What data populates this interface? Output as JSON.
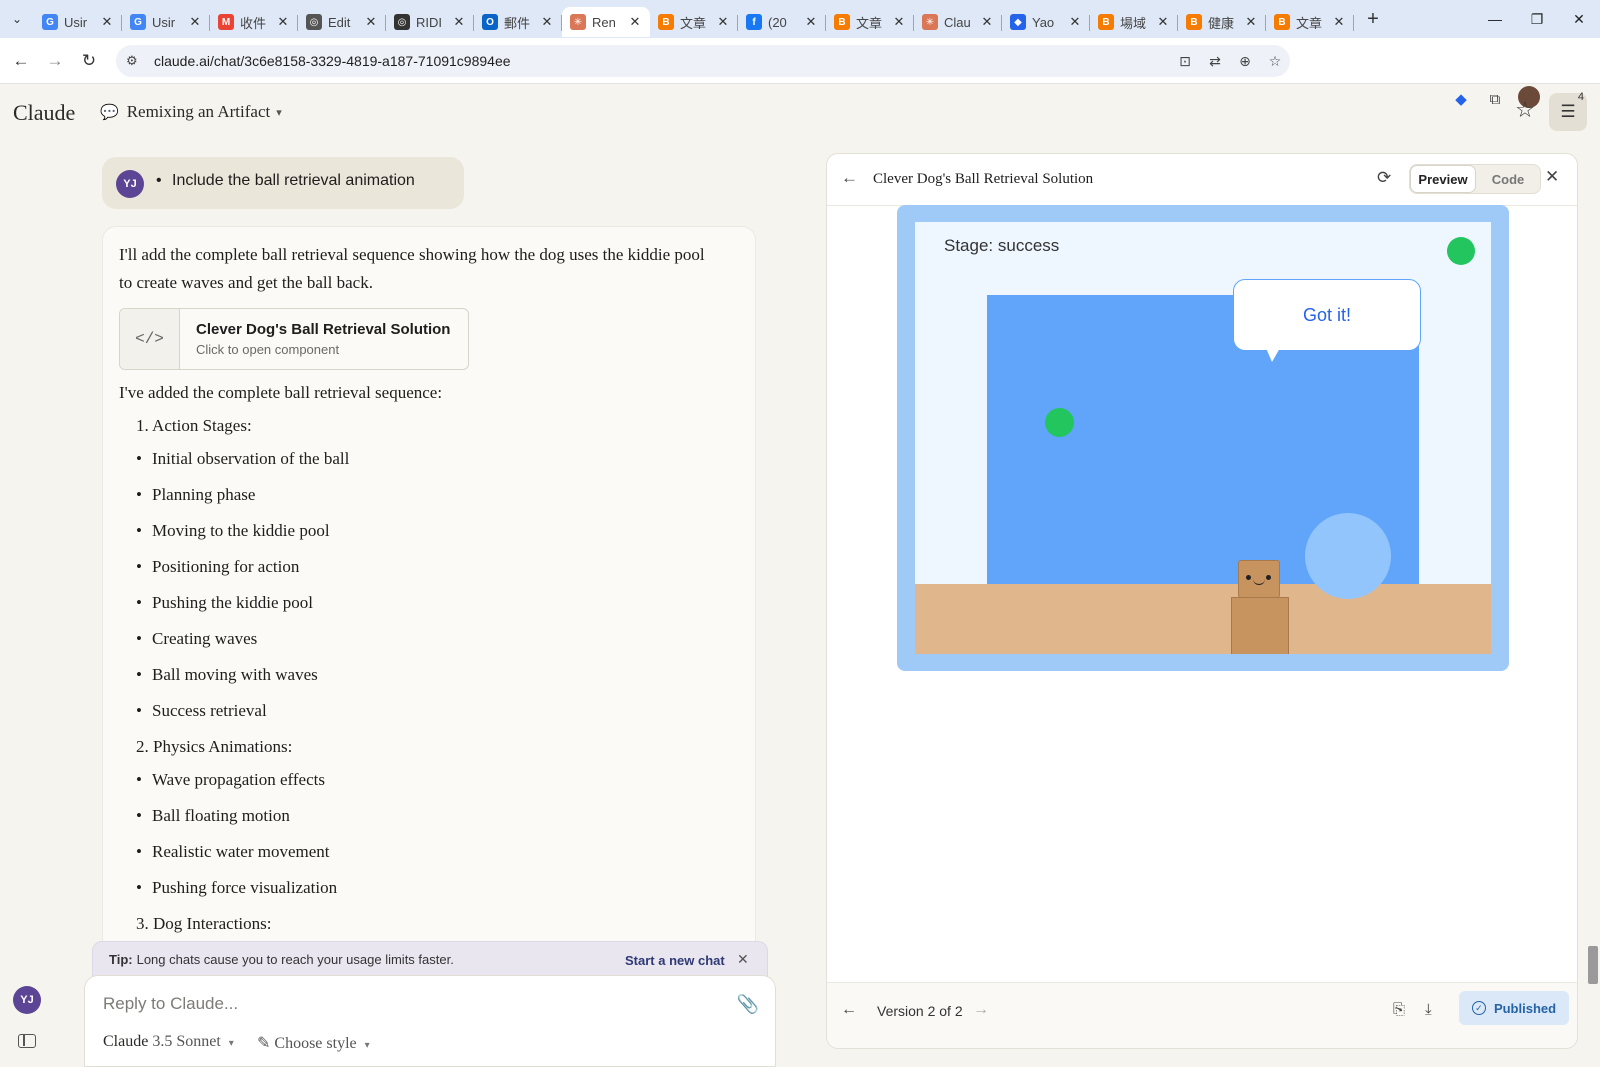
{
  "browser": {
    "tabs": [
      {
        "label": "Usir",
        "favicon_color": "#4285f4",
        "favicon_glyph": "G",
        "active": false
      },
      {
        "label": "Usir",
        "favicon_color": "#4285f4",
        "favicon_glyph": "G",
        "active": false
      },
      {
        "label": "收件",
        "favicon_color": "#ea4335",
        "favicon_glyph": "M",
        "active": false
      },
      {
        "label": "Edit",
        "favicon_color": "#555555",
        "favicon_glyph": "◎",
        "active": false
      },
      {
        "label": "RIDI",
        "favicon_color": "#333333",
        "favicon_glyph": "◎",
        "active": false
      },
      {
        "label": "郵件",
        "favicon_color": "#0a64c8",
        "favicon_glyph": "O",
        "active": false
      },
      {
        "label": "Ren",
        "favicon_color": "#d97757",
        "favicon_glyph": "✳",
        "active": true
      },
      {
        "label": "文章",
        "favicon_color": "#f57c00",
        "favicon_glyph": "B",
        "active": false
      },
      {
        "label": "(20",
        "favicon_color": "#1877f2",
        "favicon_glyph": "f",
        "active": false
      },
      {
        "label": "文章",
        "favicon_color": "#f57c00",
        "favicon_glyph": "B",
        "active": false
      },
      {
        "label": "Clau",
        "favicon_color": "#d97757",
        "favicon_glyph": "✳",
        "active": false
      },
      {
        "label": "Yao",
        "favicon_color": "#2563eb",
        "favicon_glyph": "◆",
        "active": false
      },
      {
        "label": "場域",
        "favicon_color": "#f57c00",
        "favicon_glyph": "B",
        "active": false
      },
      {
        "label": "健康",
        "favicon_color": "#f57c00",
        "favicon_glyph": "B",
        "active": false
      },
      {
        "label": "文章",
        "favicon_color": "#f57c00",
        "favicon_glyph": "B",
        "active": false
      }
    ],
    "url": "claude.ai/chat/3c6e8158-3329-4819-a187-71091c9894ee"
  },
  "app": {
    "brand": "Claude",
    "conversation_title": "Remixing an Artifact",
    "settings_badge": "4"
  },
  "chat": {
    "user_initials": "YJ",
    "user_message": "Include the ball retrieval animation",
    "assistant_intro": "I'll add the complete ball retrieval sequence showing how the dog uses the kiddie pool to create waves and get the ball back.",
    "artifact_card": {
      "title": "Clever Dog's Ball Retrieval Solution",
      "subtitle": "Click to open component"
    },
    "assistant_summary": "I've added the complete ball retrieval sequence:",
    "list": [
      {
        "type": "num",
        "text": "1. Action Stages:"
      },
      {
        "type": "bullet",
        "text": "Initial observation of the ball"
      },
      {
        "type": "bullet",
        "text": "Planning phase"
      },
      {
        "type": "bullet",
        "text": "Moving to the kiddie pool"
      },
      {
        "type": "bullet",
        "text": "Positioning for action"
      },
      {
        "type": "bullet",
        "text": "Pushing the kiddie pool"
      },
      {
        "type": "bullet",
        "text": "Creating waves"
      },
      {
        "type": "bullet",
        "text": "Ball moving with waves"
      },
      {
        "type": "bullet",
        "text": "Success retrieval"
      },
      {
        "type": "num",
        "text": "2. Physics Animations:"
      },
      {
        "type": "bullet",
        "text": "Wave propagation effects"
      },
      {
        "type": "bullet",
        "text": "Ball floating motion"
      },
      {
        "type": "bullet",
        "text": "Realistic water movement"
      },
      {
        "type": "bullet",
        "text": "Pushing force visualization"
      },
      {
        "type": "num",
        "text": "3. Dog Interactions:"
      }
    ]
  },
  "tip": {
    "label": "Tip:",
    "text": "Long chats cause you to reach your usage limits faster.",
    "link": "Start a new chat"
  },
  "composer": {
    "placeholder": "Reply to Claude...",
    "model_name": "Claude",
    "model_version": "3.5 Sonnet",
    "style_label": "Choose style"
  },
  "artifact_panel": {
    "title": "Clever Dog's Ball Retrieval Solution",
    "preview_label": "Preview",
    "code_label": "Code",
    "version_text": "Version 2 of 2",
    "published_label": "Published",
    "game": {
      "stage_text": "Stage: success",
      "speech": "Got it!",
      "colors": {
        "water": "#60a5fa",
        "ground": "#e0b78d",
        "ball": "#22c55e",
        "dog": "#c7935f"
      }
    }
  }
}
